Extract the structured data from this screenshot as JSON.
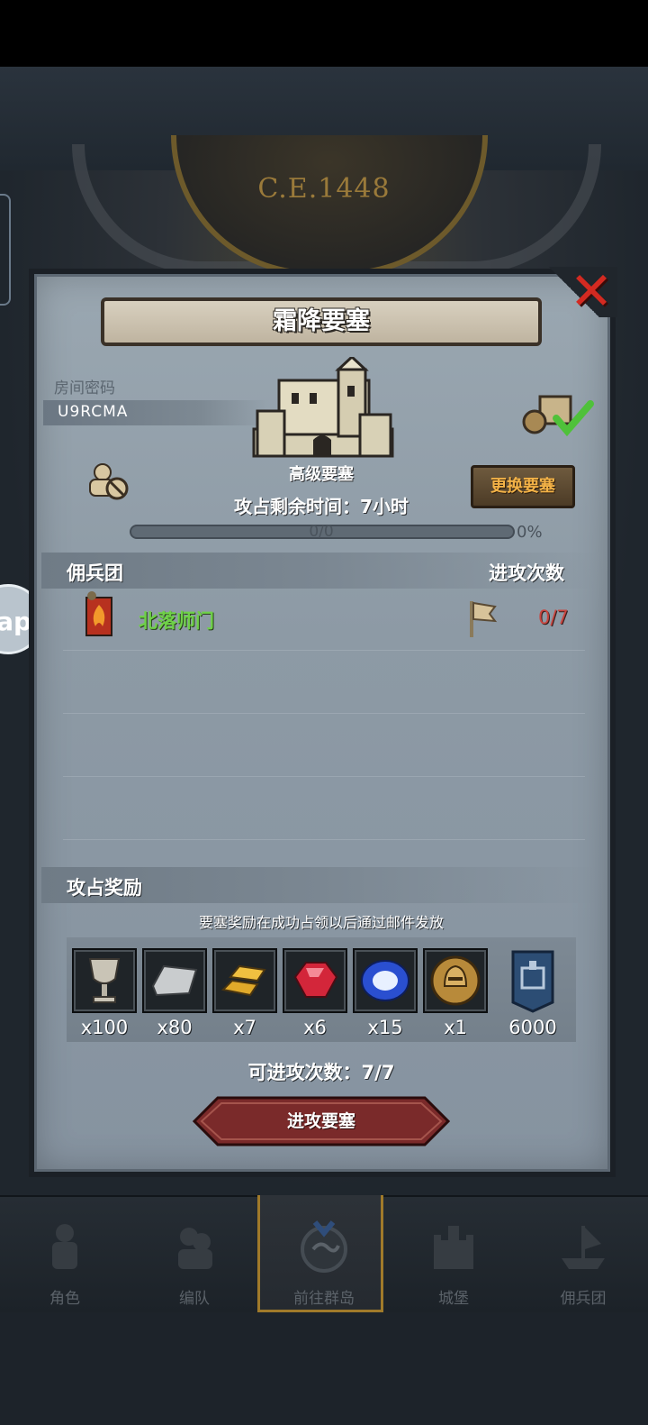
{
  "background": {
    "era_label": "C.E.1448",
    "side_bubble_text": "ap"
  },
  "dialog": {
    "title": "霜降要塞",
    "room": {
      "label": "房间密码",
      "code": "U9RCMA"
    },
    "fortress_type": "高级要塞",
    "time_remaining": "攻占剩余时间：7小时",
    "change_button": "更换要塞",
    "progress": {
      "text": "0/0",
      "percent_label": "0%",
      "value": 0
    },
    "guild_section": {
      "left_header": "佣兵团",
      "right_header": "进攻次数"
    },
    "guilds": [
      {
        "name": "北落师门",
        "attacks": "0/7"
      }
    ],
    "reward_section": {
      "header": "攻占奖励",
      "note": "要塞奖励在成功占领以后通过邮件发放",
      "items": [
        {
          "icon": "goblet-icon",
          "qty": "x100"
        },
        {
          "icon": "iron-ingot-icon",
          "qty": "x80"
        },
        {
          "icon": "gold-bars-icon",
          "qty": "x7"
        },
        {
          "icon": "ruby-icon",
          "qty": "x6"
        },
        {
          "icon": "sapphire-icon",
          "qty": "x15"
        },
        {
          "icon": "helmet-medal-icon",
          "qty": "x1"
        },
        {
          "icon": "fortress-banner-icon",
          "qty": "6000"
        }
      ]
    },
    "attempts": "可进攻次数：7/7",
    "attack_button": "进攻要塞"
  },
  "nav": {
    "items": [
      {
        "label": "角色",
        "icon": "knight-icon"
      },
      {
        "label": "编队",
        "icon": "formation-icon"
      },
      {
        "label": "前往群岛",
        "icon": "islands-icon",
        "active": true
      },
      {
        "label": "城堡",
        "icon": "castle-icon"
      },
      {
        "label": "佣兵团",
        "icon": "ship-icon"
      }
    ]
  },
  "colors": {
    "panel": "#8d9aa5",
    "guild_name": "#6fd148",
    "attack_count": "#c9453f",
    "change_button_text": "#f3b247",
    "attack_button": "#7a2a2a",
    "close": "#d32a21"
  }
}
